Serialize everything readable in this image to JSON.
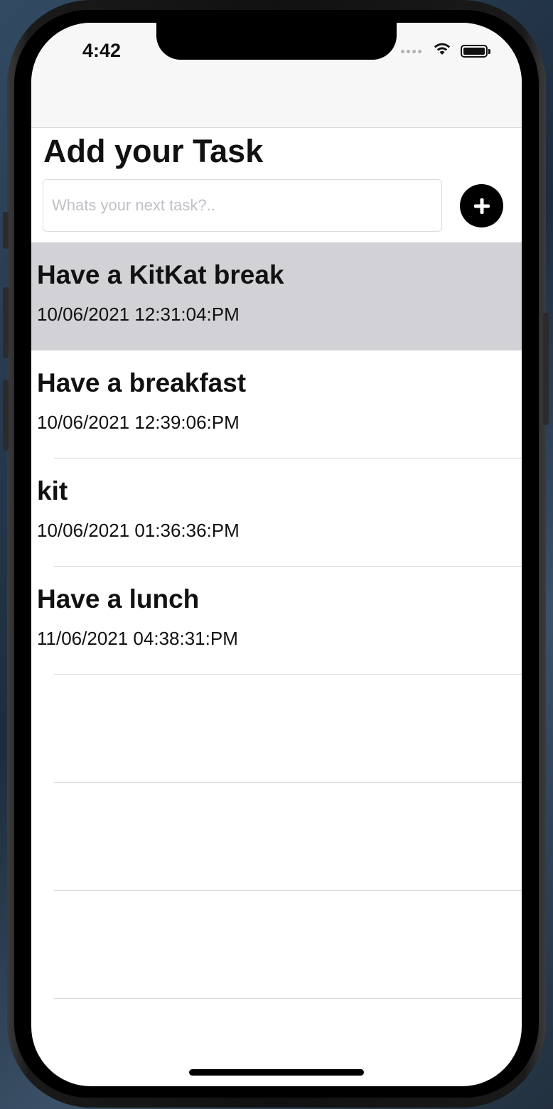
{
  "status_bar": {
    "time": "4:42"
  },
  "header": {
    "title": "Add your Task"
  },
  "input": {
    "placeholder": "Whats your next task?..",
    "value": ""
  },
  "add_button": {
    "icon": "plus-circle-icon"
  },
  "tasks": [
    {
      "title": "Have a KitKat break",
      "date": "10/06/2021 12:31:04:PM",
      "selected": true
    },
    {
      "title": "Have a breakfast",
      "date": "10/06/2021 12:39:06:PM",
      "selected": false
    },
    {
      "title": "kit",
      "date": "10/06/2021 01:36:36:PM",
      "selected": false
    },
    {
      "title": "Have a lunch",
      "date": "11/06/2021 04:38:31:PM",
      "selected": false
    }
  ],
  "colors": {
    "selected_row": "#d1d1d6",
    "accent": "#000000"
  }
}
